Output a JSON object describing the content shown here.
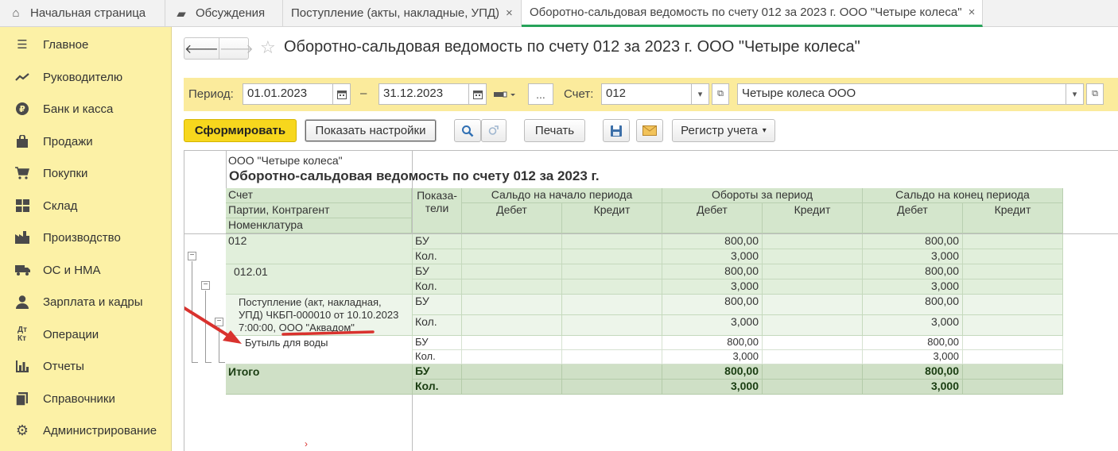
{
  "tabs": [
    {
      "label": "Начальная страница",
      "icon": "home-icon"
    },
    {
      "label": "Обсуждения",
      "icon": "chat-icon"
    },
    {
      "label": "Поступление (акты, накладные, УПД)",
      "close": "×"
    },
    {
      "label": "Оборотно-сальдовая ведомость по счету 012 за 2023 г. ООО \"Четыре колеса\"",
      "close": "×"
    }
  ],
  "sidebar": {
    "items": [
      {
        "label": "Главное",
        "icon": "menu-icon"
      },
      {
        "label": "Руководителю",
        "icon": "trend-icon"
      },
      {
        "label": "Банк и касса",
        "icon": "ruble-icon"
      },
      {
        "label": "Продажи",
        "icon": "bag-icon"
      },
      {
        "label": "Покупки",
        "icon": "cart-icon"
      },
      {
        "label": "Склад",
        "icon": "warehouse-icon"
      },
      {
        "label": "Производство",
        "icon": "factory-icon"
      },
      {
        "label": "ОС и НМА",
        "icon": "truck-icon"
      },
      {
        "label": "Зарплата и кадры",
        "icon": "person-icon"
      },
      {
        "label": "Операции",
        "icon": "operations-icon"
      },
      {
        "label": "Отчеты",
        "icon": "bar-chart-icon"
      },
      {
        "label": "Справочники",
        "icon": "books-icon"
      },
      {
        "label": "Администрирование",
        "icon": "gear-icon"
      }
    ]
  },
  "header": {
    "title": "Оборотно-сальдовая ведомость по счету 012 за 2023 г. ООО \"Четыре колеса\""
  },
  "period": {
    "label": "Период:",
    "from": "01.01.2023",
    "dash": "–",
    "to": "31.12.2023",
    "ellipsis": "...",
    "account_label": "Счет:",
    "account": "012",
    "org": "Четыре колеса ООО"
  },
  "toolbar": {
    "generate": "Сформировать",
    "show_settings": "Показать настройки",
    "print": "Печать",
    "register": "Регистр учета"
  },
  "report": {
    "org": "ООО \"Четыре колеса\"",
    "title": "Оборотно-сальдовая ведомость по счету 012 за 2023 г.",
    "left_headers": [
      "Счет",
      "Партии, Контрагент",
      "Номенклатура"
    ],
    "indicator_header": "Показа-\nтели",
    "groups": [
      "Сальдо на начало периода",
      "Обороты за период",
      "Сальдо на конец периода"
    ],
    "debit": "Дебет",
    "credit": "Кредит",
    "rows": [
      {
        "name": "012",
        "ind": [
          "БУ",
          "Кол."
        ],
        "turn_debit": [
          "800,00",
          "3,000"
        ],
        "end_debit": [
          "800,00",
          "3,000"
        ]
      },
      {
        "name": "012.01",
        "ind": [
          "БУ",
          "Кол."
        ],
        "turn_debit": [
          "800,00",
          "3,000"
        ],
        "end_debit": [
          "800,00",
          "3,000"
        ]
      },
      {
        "name": "Поступление (акт, накладная, УПД) ЧКБП-000010 от 10.10.2023 7:00:00, ООО \"Аквадом\"",
        "lines": [
          "Поступление (акт, накладная,",
          "УПД) ЧКБП-000010 от 10.10.2023",
          "7:00:00, ООО \"Аквадом\""
        ],
        "ind": [
          "БУ",
          "Кол."
        ],
        "turn_debit": [
          "800,00",
          "3,000"
        ],
        "end_debit": [
          "800,00",
          "3,000"
        ]
      },
      {
        "name": "Бутыль для воды",
        "ind": [
          "БУ",
          "Кол."
        ],
        "turn_debit": [
          "800,00",
          "3,000"
        ],
        "end_debit": [
          "800,00",
          "3,000"
        ]
      }
    ],
    "total": {
      "name": "Итого",
      "ind": [
        "БУ",
        "Кол."
      ],
      "turn_debit": [
        "800,00",
        "3,000"
      ],
      "end_debit": [
        "800,00",
        "3,000"
      ]
    },
    "tree_toggle": "−",
    "cursor_mark": "›"
  },
  "colors": {
    "accent": "#f7d71d",
    "sidebar": "#fcf1a6",
    "annotation": "#d9322e",
    "active_tab": "#27a35a"
  }
}
